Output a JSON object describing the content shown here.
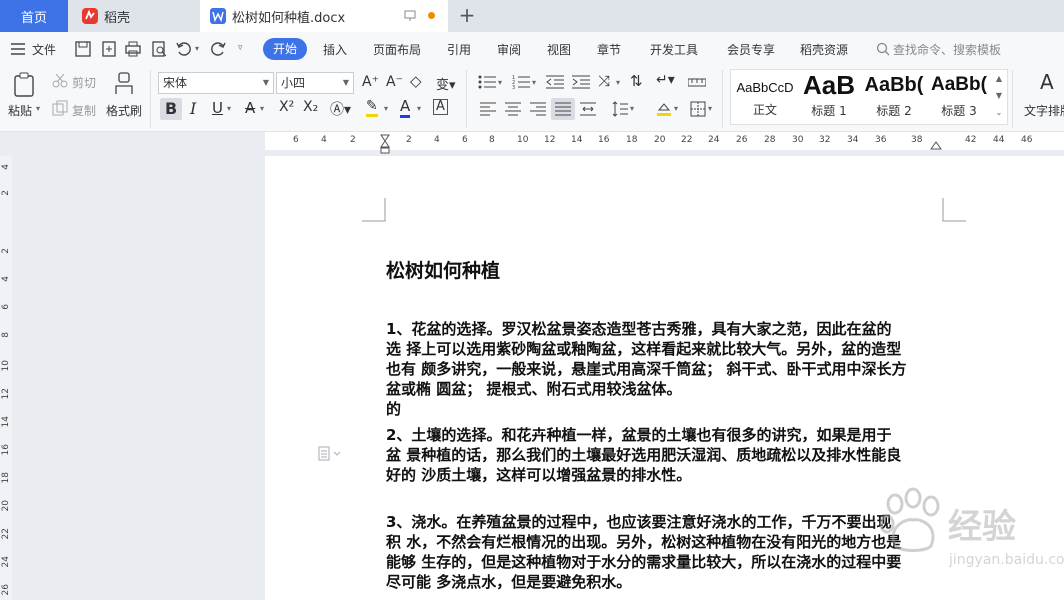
{
  "tabs": {
    "home": "首页",
    "daoke": "稻壳",
    "doc": "松树如何种植.docx"
  },
  "menu": {
    "file": "文件",
    "items": [
      "开始",
      "插入",
      "页面布局",
      "引用",
      "审阅",
      "视图",
      "章节",
      "开发工具",
      "会员专享",
      "稻壳资源"
    ],
    "search": "查找命令、搜索模板"
  },
  "ribbon": {
    "paste": "粘贴",
    "cut": "剪切",
    "copy": "复制",
    "format_painter": "格式刷",
    "font_name": "宋体",
    "font_size": "小四",
    "text_layout": "文字排版",
    "styles": [
      {
        "sample": "AaBbCcD",
        "name": "正文"
      },
      {
        "sample": "AaB",
        "name": "标题 1"
      },
      {
        "sample": "AaBb(",
        "name": "标题 2"
      },
      {
        "sample": "AaBb(",
        "name": "标题 3"
      }
    ]
  },
  "ruler": {
    "h_ticks": [
      "6",
      "4",
      "2",
      "2",
      "4",
      "6",
      "8",
      "10",
      "12",
      "14",
      "16",
      "18",
      "20",
      "22",
      "24",
      "26",
      "28",
      "30",
      "32",
      "34",
      "36",
      "38",
      "42",
      "44",
      "46"
    ],
    "v_ticks": [
      "4",
      "2",
      "2",
      "4",
      "6",
      "8",
      "10",
      "12",
      "14",
      "16",
      "18",
      "20",
      "22",
      "24",
      "26"
    ]
  },
  "document": {
    "title": "松树如何种植",
    "paragraphs": [
      {
        "lines": [
          "1、花盆的选择。罗汉松盆景姿态造型苍古秀雅，具有大家之范，因此在盆的",
          "选  择上可以选用紫砂陶盆或釉陶盆，这样看起来就比较大气。另外，盆的造型",
          "也有  颇多讲究，一般来说，悬崖式用高深千筒盆；   斜干式、卧干式用中深长方",
          "盆或椭  圆盆；  提根式、附石式用较浅盆体。",
          "的"
        ]
      },
      {
        "lines": [
          "2、土壤的选择。和花卉种植一样，盆景的土壤也有很多的讲究，如果是用于",
          "盆  景种植的话，那么我们的土壤最好选用肥沃湿润、质地疏松以及排水性能良",
          "好的  沙质土壤，这样可以增强盆景的排水性。"
        ]
      },
      {
        "lines": [
          "3、浇水。在养殖盆景的过程中，也应该要注意好浇水的工作，千万不要出现",
          "积  水，不然会有烂根情况的出现。另外，松树这种植物在没有阳光的地方也是",
          "能够  生存的，但是这种植物对于水分的需求量比较大，所以在浇水的过程中要",
          "尽可能  多浇点水，但是要避免积水。"
        ]
      }
    ]
  },
  "watermark": {
    "text": "经验",
    "url": "jingyan.baidu.com"
  }
}
